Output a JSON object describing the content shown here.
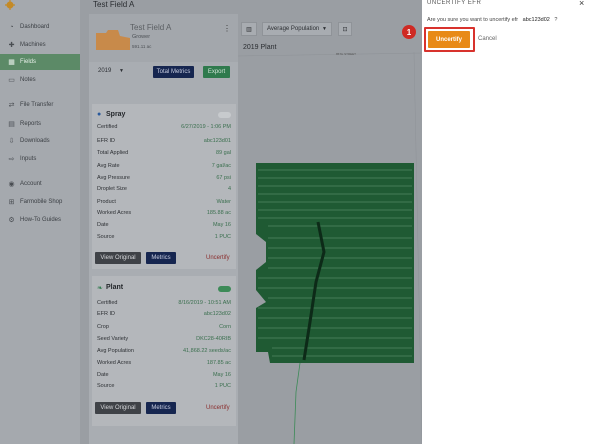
{
  "page": {
    "title": "Test Field A"
  },
  "sidebar": {
    "items": [
      {
        "label": "Dashboard",
        "icon": "dashboard-icon"
      },
      {
        "label": "Machines",
        "icon": "machine-icon"
      },
      {
        "label": "Fields",
        "icon": "fields-icon",
        "active": true
      },
      {
        "label": "Notes",
        "icon": "notes-icon"
      },
      {
        "label": "File Transfer",
        "icon": "transfer-icon"
      },
      {
        "label": "Reports",
        "icon": "reports-icon"
      },
      {
        "label": "Downloads",
        "icon": "download-icon"
      },
      {
        "label": "Inputs",
        "icon": "inputs-icon"
      },
      {
        "label": "Account",
        "icon": "account-icon"
      },
      {
        "label": "Farmobile Shop",
        "icon": "shop-icon"
      },
      {
        "label": "How-To Guides",
        "icon": "guides-icon"
      }
    ]
  },
  "field": {
    "name": "Test Field A",
    "grower": "Grower",
    "acres": "591.11 ac"
  },
  "controls": {
    "year": "2019",
    "total_metrics": "Total Metrics",
    "export": "Export"
  },
  "spray": {
    "title": "Spray",
    "rows": [
      {
        "label": "Certified",
        "value": "6/27/2019 - 1:06 PM"
      },
      {
        "label": "EFR ID",
        "value": "abc123d01"
      },
      {
        "label": "Total Applied",
        "value": "89 gal"
      },
      {
        "label": "Avg Rate",
        "value": "7 gal/ac"
      },
      {
        "label": "Avg Pressure",
        "value": "67 psi"
      },
      {
        "label": "Droplet Size",
        "value": "4"
      },
      {
        "label": "Product",
        "value": "Water"
      },
      {
        "label": "Worked Acres",
        "value": "185.88 ac"
      },
      {
        "label": "Date",
        "value": "May 16"
      },
      {
        "label": "Source",
        "value": "1 PUC"
      }
    ],
    "view_original": "View Original",
    "metrics": "Metrics",
    "uncertify": "Uncertify"
  },
  "plant": {
    "title": "Plant",
    "rows": [
      {
        "label": "Certified",
        "value": "8/16/2019 - 10:51 AM"
      },
      {
        "label": "EFR ID",
        "value": "abc123d02"
      },
      {
        "label": "Crop",
        "value": "Corn"
      },
      {
        "label": "Seed Variety",
        "value": "DKC28-40RIB"
      },
      {
        "label": "Avg Population",
        "value": "41,868.22 seeds/ac"
      },
      {
        "label": "Worked Acres",
        "value": "187.85 ac"
      },
      {
        "label": "Date",
        "value": "May 16"
      },
      {
        "label": "Source",
        "value": "1 PUC"
      }
    ],
    "view_original": "View Original",
    "metrics": "Metrics",
    "uncertify": "Uncertify"
  },
  "map": {
    "layer_select": "Average Population",
    "plant_label": "2019 Plant",
    "road_label": "85TH STREET"
  },
  "dialog": {
    "title": "UNCERTIFY EFR",
    "question": "Are you sure you want to uncertify efr",
    "efr_id": "abc123d02",
    "question_end": "?",
    "uncertify_button": "Uncertify",
    "cancel": "Cancel",
    "step_badge": "1"
  },
  "colors": {
    "active_nav": "#5c8a67",
    "uncertify_button": "#e88a17",
    "highlight": "#d8322d",
    "navy": "#162650",
    "export_green": "#2f7a4d"
  }
}
